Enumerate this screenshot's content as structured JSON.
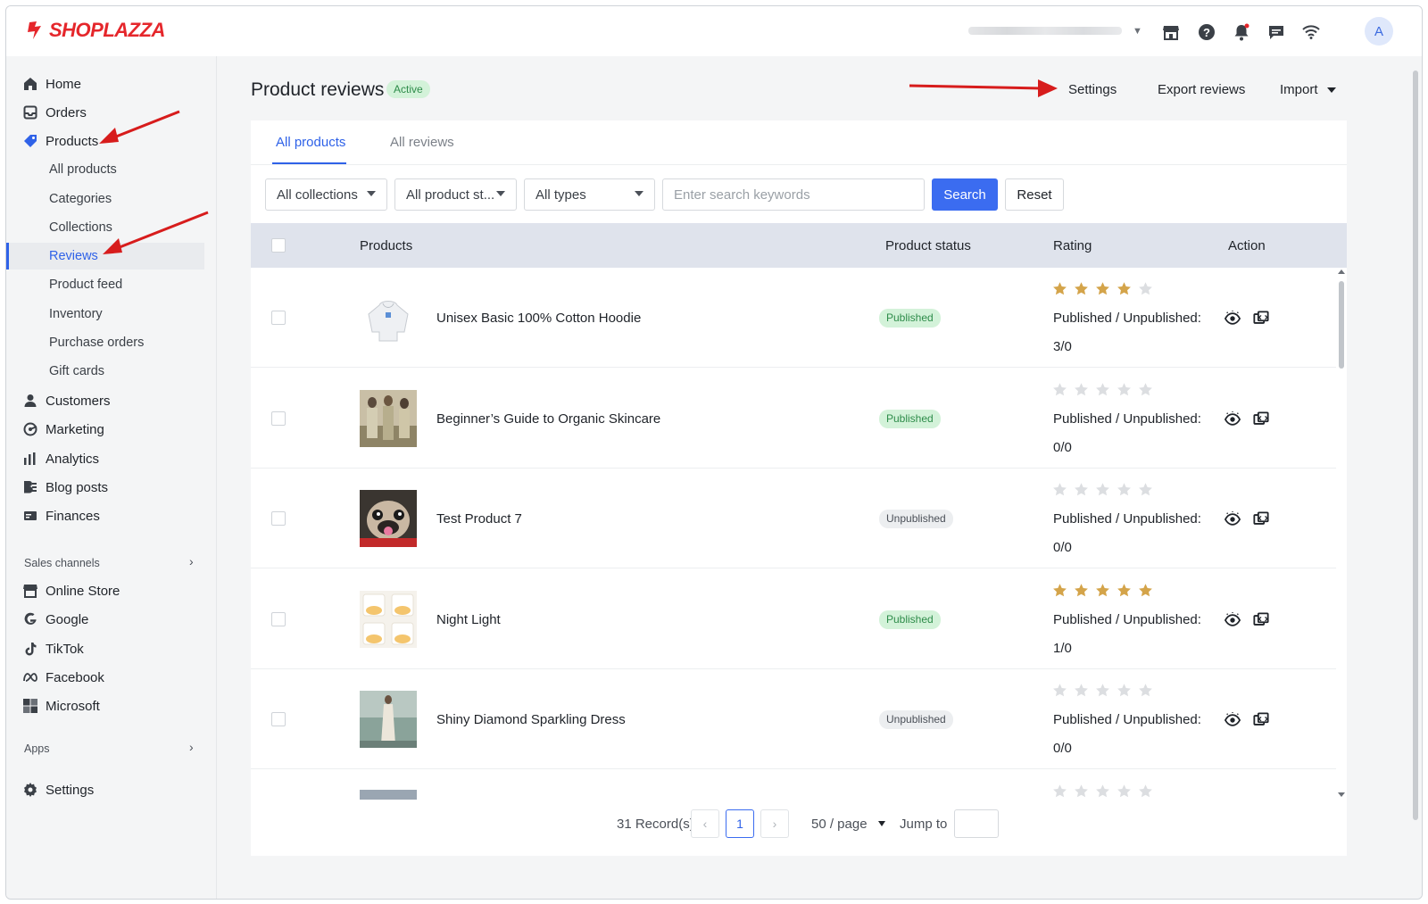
{
  "app": {
    "brand": "SHOPLAZZA",
    "brand_color": "#e5262b",
    "avatar_letter": "A"
  },
  "topbar_icons": [
    "store-icon",
    "help-icon",
    "bell-icon",
    "chat-icon",
    "wifi-icon"
  ],
  "sidebar": {
    "items": [
      {
        "label": "Home",
        "icon": "home-icon"
      },
      {
        "label": "Orders",
        "icon": "inbox-icon"
      },
      {
        "label": "Products",
        "icon": "tag-icon",
        "active_parent": true
      },
      {
        "label": "All products"
      },
      {
        "label": "Categories"
      },
      {
        "label": "Collections"
      },
      {
        "label": "Reviews",
        "active": true
      },
      {
        "label": "Product feed"
      },
      {
        "label": "Inventory"
      },
      {
        "label": "Purchase orders"
      },
      {
        "label": "Gift cards"
      },
      {
        "label": "Customers",
        "icon": "person-icon"
      },
      {
        "label": "Marketing",
        "icon": "marketing-icon"
      },
      {
        "label": "Analytics",
        "icon": "bar-chart-icon"
      },
      {
        "label": "Blog posts",
        "icon": "blog-icon"
      },
      {
        "label": "Finances",
        "icon": "finance-icon"
      }
    ],
    "sales_channels_label": "Sales channels",
    "channels": [
      {
        "label": "Online Store",
        "icon": "store-icon"
      },
      {
        "label": "Google",
        "icon": "google-icon"
      },
      {
        "label": "TikTok",
        "icon": "tiktok-icon"
      },
      {
        "label": "Facebook",
        "icon": "meta-icon"
      },
      {
        "label": "Microsoft",
        "icon": "microsoft-icon"
      }
    ],
    "apps_label": "Apps",
    "settings_label": "Settings"
  },
  "header": {
    "title": "Product reviews",
    "badge": "Active",
    "settings": "Settings",
    "export": "Export reviews",
    "import": "Import"
  },
  "tabs": [
    {
      "label": "All products",
      "active": true
    },
    {
      "label": "All reviews"
    }
  ],
  "filters": {
    "collections": "All collections",
    "product_status": "All product st...",
    "types": "All types",
    "search_placeholder": "Enter search keywords",
    "search_button": "Search",
    "reset_button": "Reset"
  },
  "table": {
    "columns": [
      "Products",
      "Product status",
      "Rating",
      "Action"
    ],
    "rows": [
      {
        "name": "Unisex Basic 100% Cotton Hoodie",
        "status": "Published",
        "rating": 4,
        "pub_label": "Published / Unpublished:",
        "counts": "3/0",
        "thumb": "hoodie"
      },
      {
        "name": "Beginner’s Guide to Organic Skincare",
        "status": "Published",
        "rating": 0,
        "pub_label": "Published / Unpublished:",
        "counts": "0/0",
        "thumb": "people"
      },
      {
        "name": "Test Product 7",
        "status": "Unpublished",
        "rating": 0,
        "pub_label": "Published / Unpublished:",
        "counts": "0/0",
        "thumb": "pug"
      },
      {
        "name": "Night Light",
        "status": "Published",
        "rating": 5,
        "pub_label": "Published / Unpublished:",
        "counts": "1/0",
        "thumb": "lights"
      },
      {
        "name": "Shiny Diamond Sparkling Dress",
        "status": "Unpublished",
        "rating": 0,
        "pub_label": "Published / Unpublished:",
        "counts": "0/0",
        "thumb": "dress"
      }
    ]
  },
  "pagination": {
    "records": "31 Record(s)",
    "current_page": "1",
    "page_size": "50 / page",
    "jump_to": "Jump to"
  },
  "colors": {
    "accent": "#2f62e8",
    "star_filled": "#d4a44a",
    "star_empty": "#dcdee1",
    "published_bg": "#d3f2d9",
    "annotation_arrow": "#d71c1c"
  }
}
